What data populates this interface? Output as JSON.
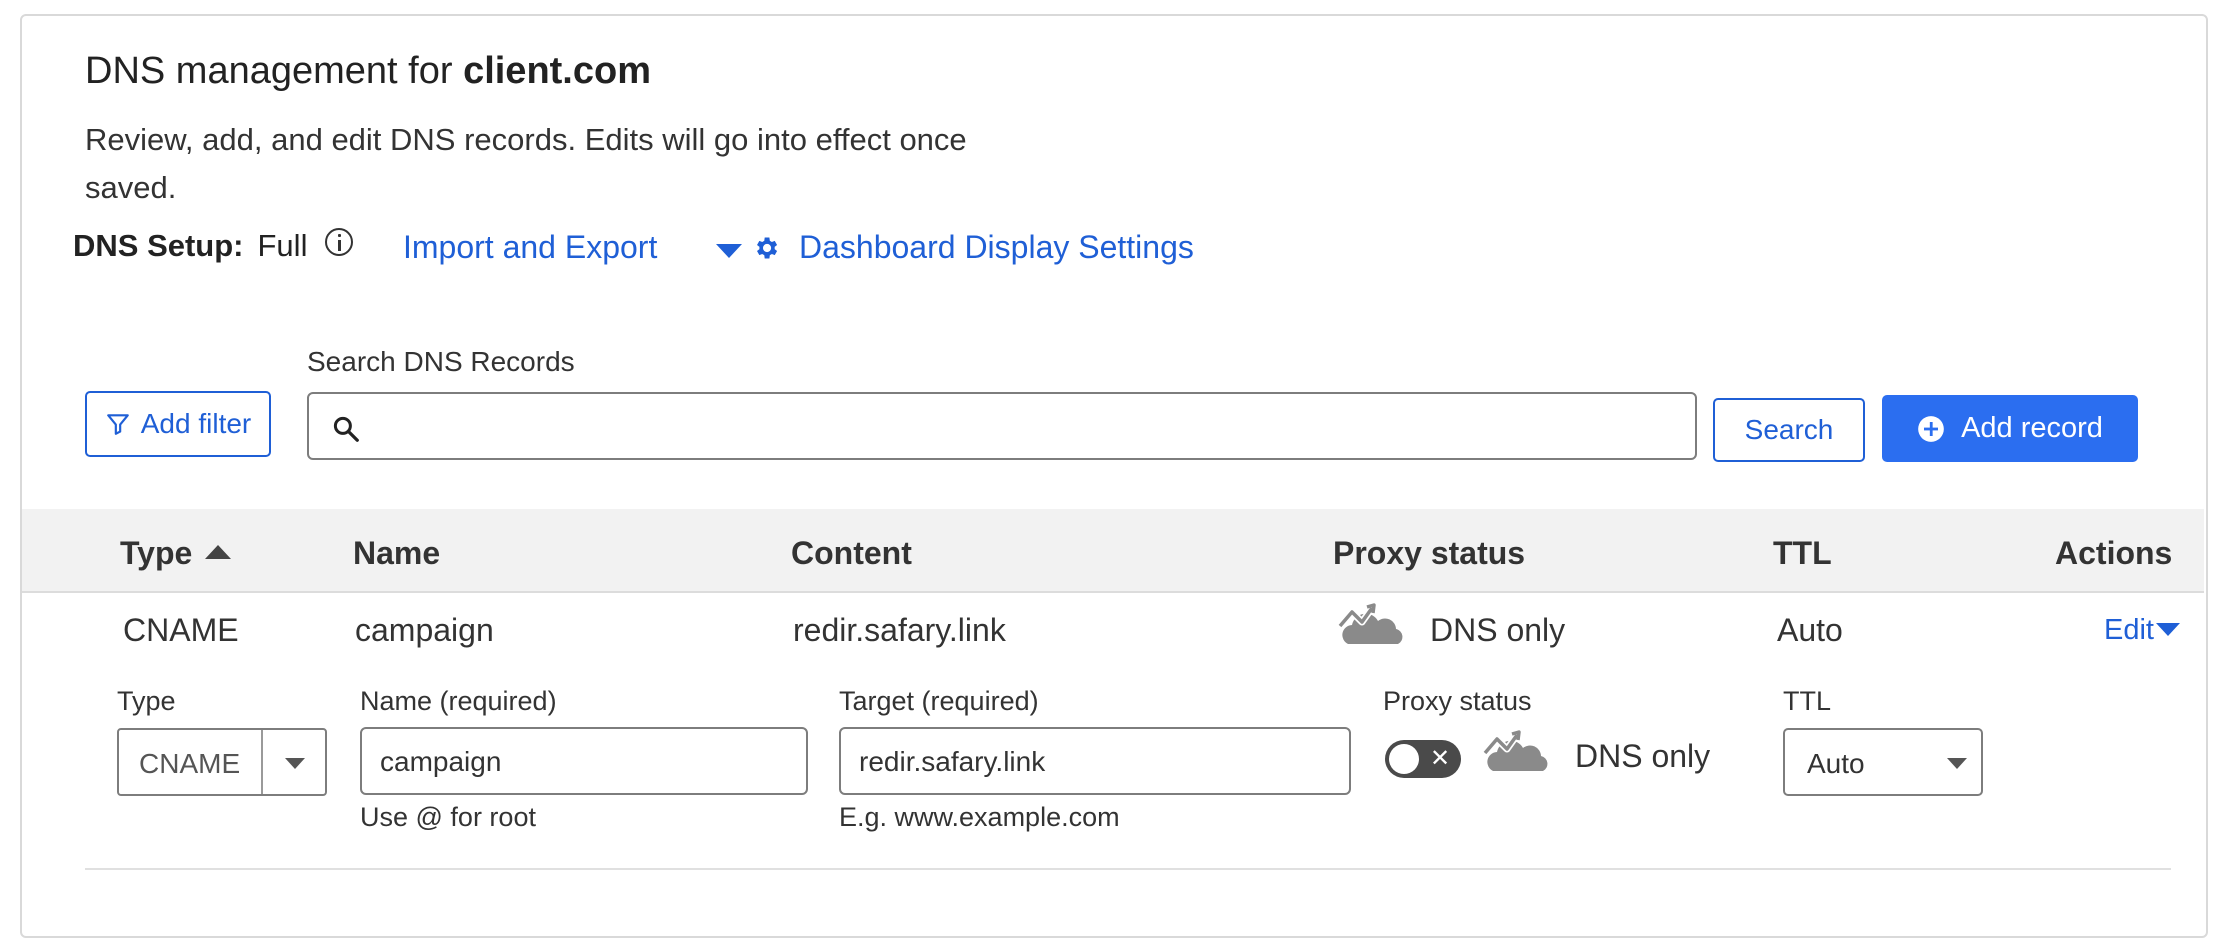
{
  "header": {
    "title_prefix": "DNS management for ",
    "domain": "client.com",
    "description": "Review, add, and edit DNS records. Edits will go into effect once saved.",
    "setup_label": "DNS Setup:",
    "setup_value": "Full",
    "import_export_label": "Import and Export",
    "dashboard_settings_label": "Dashboard Display Settings"
  },
  "toolbar": {
    "add_filter_label": "Add filter",
    "search_label": "Search DNS Records",
    "search_value": "",
    "search_button_label": "Search",
    "add_record_label": "Add record"
  },
  "table": {
    "columns": [
      "Type",
      "Name",
      "Content",
      "Proxy status",
      "TTL",
      "Actions"
    ],
    "sort_column": "Type",
    "sort_direction": "ascending",
    "rows": [
      {
        "type": "CNAME",
        "name": "campaign",
        "content": "redir.safary.link",
        "proxy_status": "DNS only",
        "ttl": "Auto",
        "action_label": "Edit"
      }
    ]
  },
  "edit_form": {
    "type_label": "Type",
    "type_value": "CNAME",
    "name_label": "Name (required)",
    "name_value": "campaign",
    "name_hint": "Use @ for root",
    "target_label": "Target (required)",
    "target_value": "redir.safary.link",
    "target_hint": "E.g. www.example.com",
    "proxy_label": "Proxy status",
    "proxy_toggle_glyph": "✕",
    "proxy_value": "DNS only",
    "proxy_enabled": false,
    "ttl_label": "TTL",
    "ttl_value": "Auto"
  },
  "colors": {
    "accent": "#2b6ef0",
    "link": "#1f5fd6",
    "header_bg": "#f2f2f2",
    "cloud_grey": "#8a8a8a"
  },
  "icons": [
    "info-icon",
    "caret-down-icon",
    "gear-icon",
    "filter-icon",
    "search-icon",
    "plus-circle-icon",
    "sort-up-icon",
    "cloud-dns-only-icon"
  ]
}
